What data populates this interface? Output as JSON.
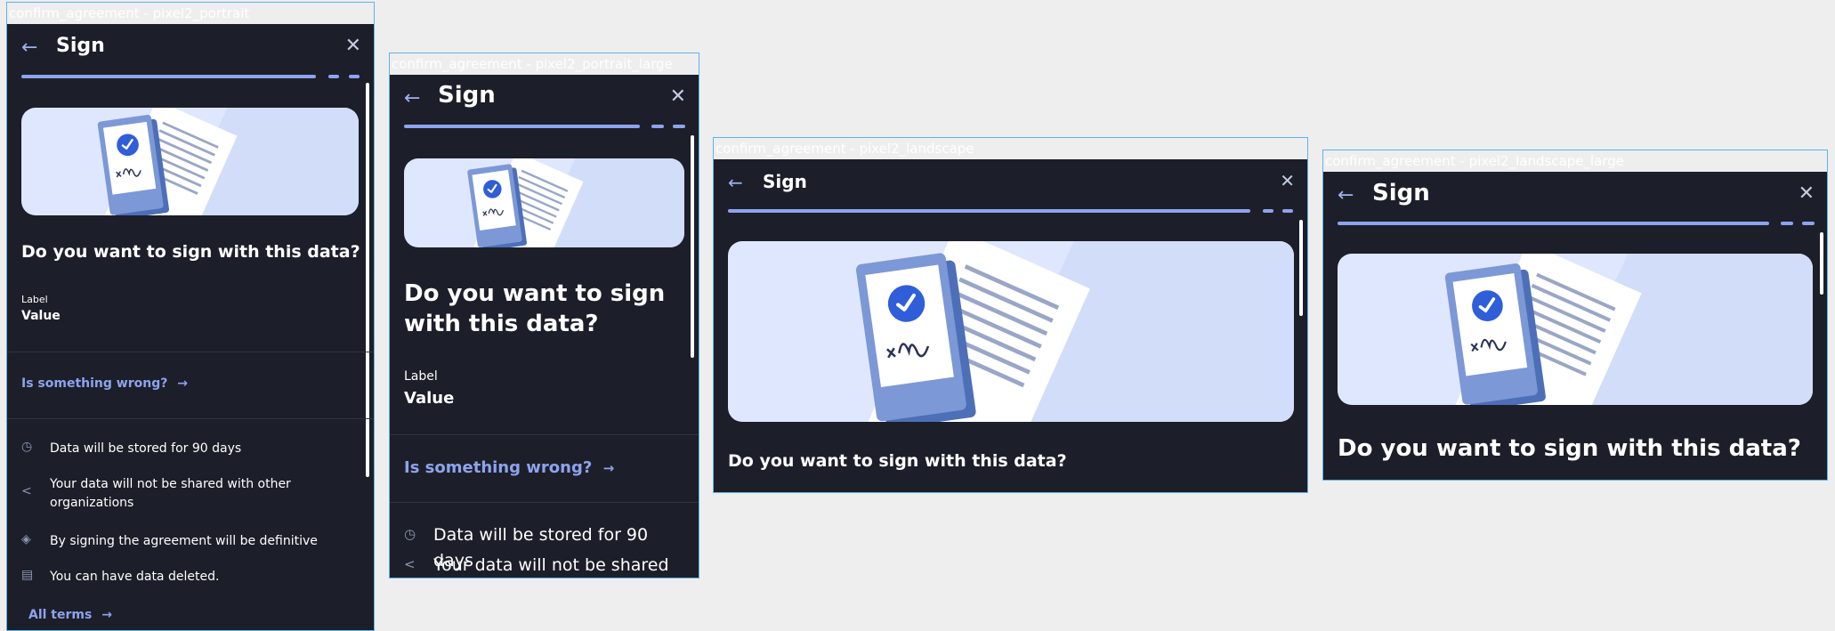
{
  "title": "Sign",
  "question": "Do you want to sign with this data?",
  "field": {
    "label": "Label",
    "value": "Value"
  },
  "wrong_link": "Is something wrong?",
  "terms_link": "All terms",
  "info_items": [
    {
      "icon": "clock-icon",
      "text": "Data will be stored for 90 days"
    },
    {
      "icon": "share-icon",
      "text": "Your data will not be shared with other organizations"
    },
    {
      "icon": "shield-icon",
      "text": "By signing the agreement will be definitive"
    },
    {
      "icon": "trash-icon",
      "text": "You can have data deleted."
    }
  ],
  "frames": [
    {
      "label": "confirm_agreement - pixel2_portrait"
    },
    {
      "label": "confirm_agreement - pixel2_portrait_large"
    },
    {
      "label": "confirm_agreement - pixel2_landscape"
    },
    {
      "label": "confirm_agreement - pixel2_landscape_large"
    }
  ],
  "icons": {
    "back": "arrow-left-icon",
    "close": "close-icon",
    "link_arrow": "arrow-right-icon"
  },
  "colors": {
    "background": "#1c1f29",
    "accent": "#8ea3ee",
    "illustration_bg": "#dfe7ff",
    "canvas": "#eeeeee",
    "frame_border": "#5fb3e6"
  }
}
